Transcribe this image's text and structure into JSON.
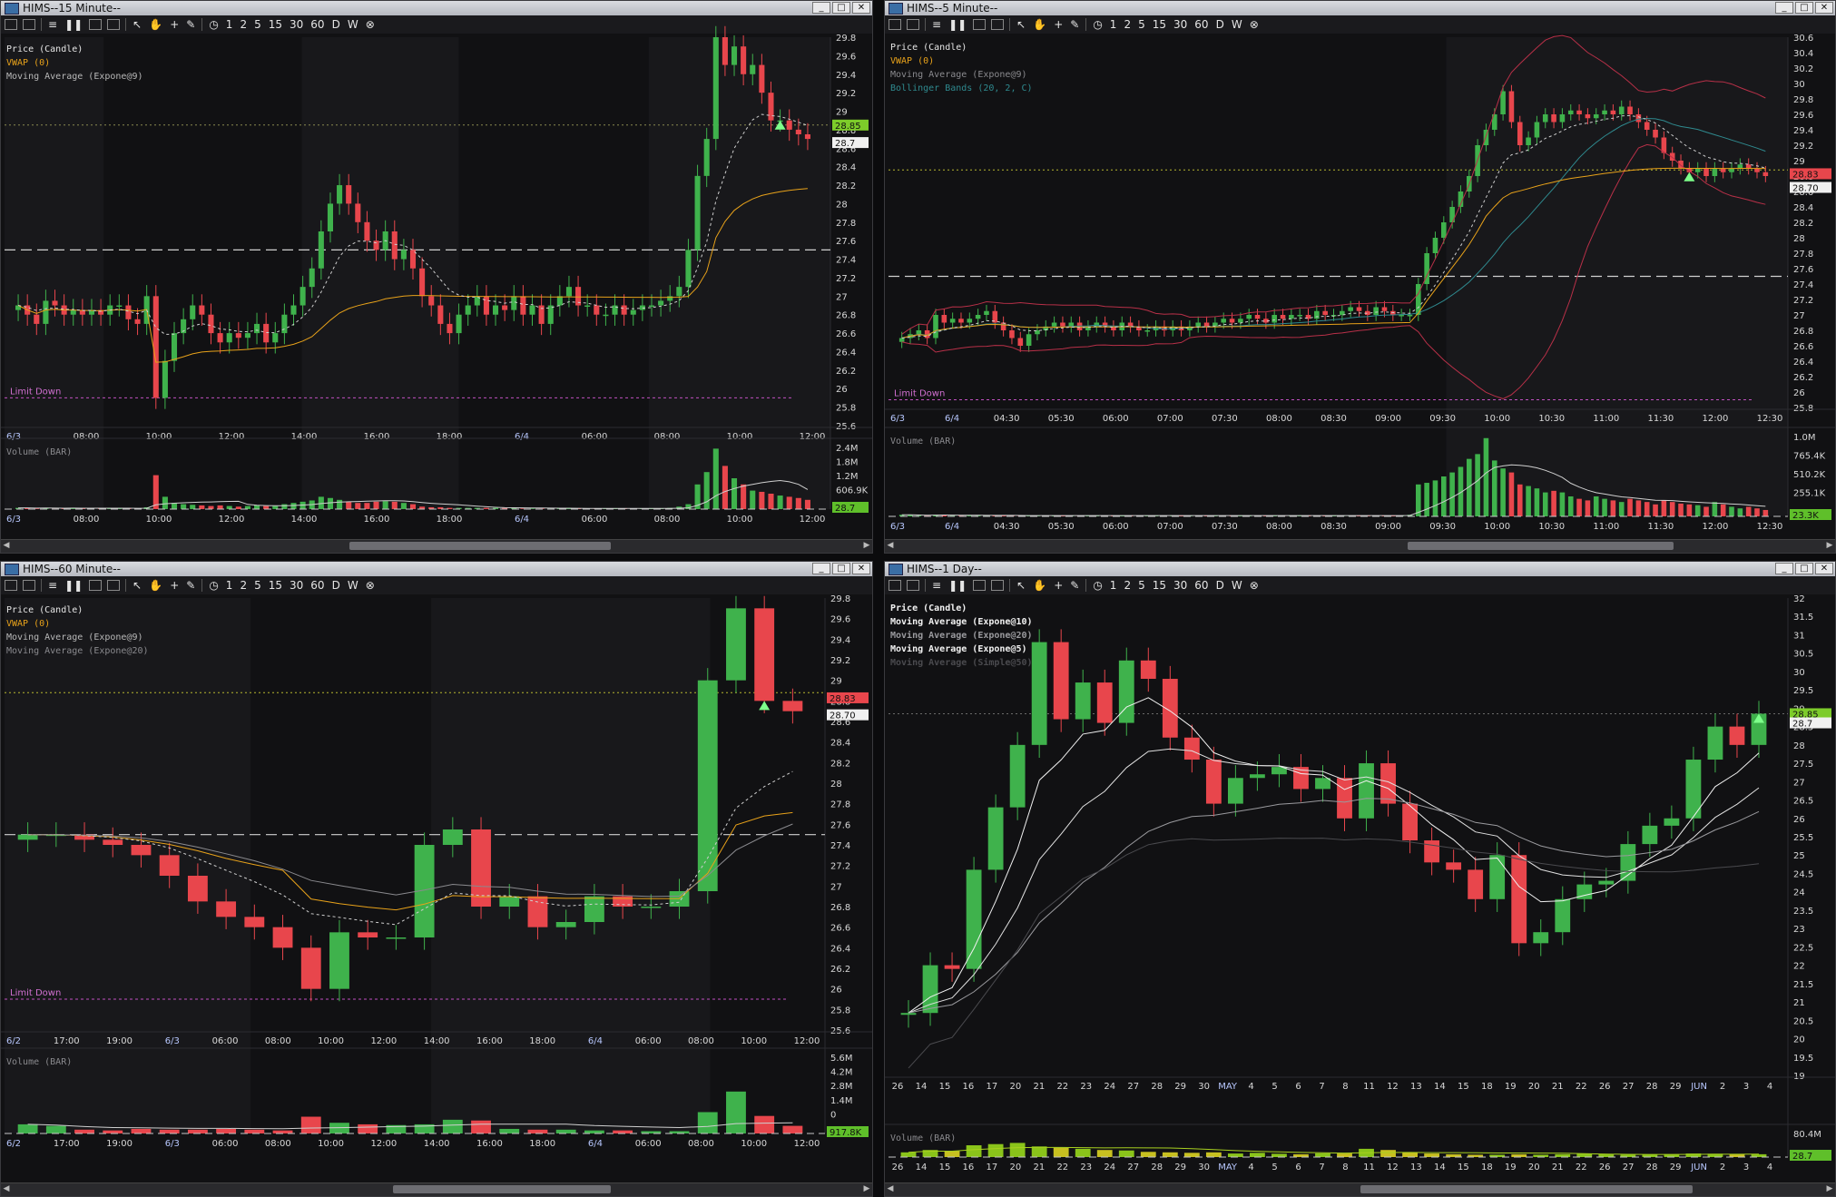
{
  "panels": [
    {
      "id": "p15",
      "title": "HIMS--15 Minute--",
      "legend": [
        {
          "text": "Price (Candle)",
          "color": "#e6e6e6"
        },
        {
          "text": "VWAP (0)",
          "color": "#e8a21a"
        },
        {
          "text": "Moving Average (Expone@9)",
          "color": "#b8b8b8"
        }
      ],
      "yticks": [
        "29.8",
        "29.6",
        "29.4",
        "29.2",
        "29",
        "28.8",
        "28.6",
        "28.4",
        "28.2",
        "28",
        "27.8",
        "27.6",
        "27.4",
        "27.2",
        "27",
        "26.8",
        "26.6",
        "26.4",
        "26.2",
        "26",
        "25.8",
        "25.6"
      ],
      "ymin": 25.6,
      "ymax": 29.8,
      "xticks": [
        "6/3",
        "08:00",
        "10:00",
        "12:00",
        "14:00",
        "16:00",
        "18:00",
        "6/4",
        "06:00",
        "08:00",
        "10:00",
        "12:00"
      ],
      "price_badges": [
        "28.85",
        "28.7"
      ],
      "limit_label": "Limit Down",
      "limit_value": 25.9,
      "dashed_level": 27.5,
      "dotted_level": 28.85,
      "volume_label": "Volume (BAR)",
      "volume_ticks": [
        "2.4M",
        "1.8M",
        "1.2M",
        "606.9K"
      ],
      "volume_badge": "28.7",
      "closes": [
        26.9,
        26.8,
        26.7,
        26.95,
        26.9,
        26.8,
        26.85,
        26.8,
        26.85,
        26.8,
        26.9,
        26.9,
        26.75,
        26.7,
        27.0,
        25.9,
        26.3,
        26.6,
        26.75,
        26.9,
        26.8,
        26.6,
        26.5,
        26.6,
        26.55,
        26.6,
        26.7,
        26.5,
        26.6,
        26.8,
        26.9,
        27.1,
        27.3,
        27.7,
        28.0,
        28.2,
        28.0,
        27.8,
        27.6,
        27.5,
        27.7,
        27.4,
        27.5,
        27.3,
        27.0,
        26.9,
        26.7,
        26.6,
        26.8,
        26.9,
        27.0,
        26.8,
        26.9,
        26.85,
        27.0,
        26.8,
        26.9,
        26.7,
        26.9,
        27.0,
        27.1,
        26.9,
        26.9,
        26.8,
        26.8,
        26.9,
        26.8,
        26.85,
        26.9,
        26.9,
        26.95,
        27.0,
        27.1,
        27.5,
        28.3,
        28.7,
        29.8,
        29.5,
        29.7,
        29.4,
        29.5,
        29.2,
        28.9,
        28.9,
        28.8,
        28.75,
        28.7
      ],
      "volumes": [
        0.02,
        0.02,
        0.01,
        0.02,
        0.01,
        0.01,
        0.02,
        0.01,
        0.01,
        0.01,
        0.02,
        0.02,
        0.01,
        0.01,
        0.03,
        0.55,
        0.2,
        0.1,
        0.08,
        0.07,
        0.06,
        0.05,
        0.06,
        0.05,
        0.04,
        0.05,
        0.06,
        0.05,
        0.05,
        0.08,
        0.1,
        0.12,
        0.14,
        0.2,
        0.18,
        0.15,
        0.12,
        0.1,
        0.1,
        0.12,
        0.13,
        0.12,
        0.1,
        0.08,
        0.04,
        0.03,
        0.03,
        0.02,
        0.02,
        0.02,
        0.02,
        0.02,
        0.02,
        0.02,
        0.02,
        0.01,
        0.01,
        0.01,
        0.01,
        0.01,
        0.01,
        0.01,
        0.01,
        0.01,
        0.01,
        0.01,
        0.01,
        0.01,
        0.01,
        0.01,
        0.01,
        0.02,
        0.04,
        0.08,
        0.4,
        0.6,
        0.98,
        0.7,
        0.5,
        0.4,
        0.3,
        0.28,
        0.25,
        0.22,
        0.2,
        0.18,
        0.15
      ]
    },
    {
      "id": "p5",
      "title": "HIMS--5 Minute--",
      "legend": [
        {
          "text": "Price (Candle)",
          "color": "#e6e6e6"
        },
        {
          "text": "VWAP (0)",
          "color": "#e8a21a"
        },
        {
          "text": "Moving Average (Expone@9)",
          "color": "#8a8a8e"
        },
        {
          "text": "Bollinger Bands (20, 2, C)",
          "color": "#2f8a8f"
        }
      ],
      "yticks": [
        "30.6",
        "30.4",
        "30.2",
        "30",
        "29.8",
        "29.6",
        "29.4",
        "29.2",
        "29",
        "28.8",
        "28.6",
        "28.4",
        "28.2",
        "28",
        "27.8",
        "27.6",
        "27.4",
        "27.2",
        "27",
        "26.8",
        "26.6",
        "26.4",
        "26.2",
        "26",
        "25.8"
      ],
      "ymin": 25.8,
      "ymax": 30.6,
      "xticks": [
        "6/3",
        "6/4",
        "04:30",
        "05:30",
        "06:00",
        "07:00",
        "07:30",
        "08:00",
        "08:30",
        "09:00",
        "09:30",
        "10:00",
        "10:30",
        "11:00",
        "11:30",
        "12:00",
        "12:30"
      ],
      "price_badges": [
        "28.83",
        "28.70"
      ],
      "limit_label": "Limit Down",
      "limit_value": 25.9,
      "dashed_level": 27.5,
      "dotted_level": 28.88,
      "volume_label": "Volume (BAR)",
      "volume_ticks": [
        "1.0M",
        "765.4K",
        "510.2K",
        "255.1K"
      ],
      "volume_badge": "23.3K",
      "closes": [
        26.7,
        26.75,
        26.8,
        26.7,
        27.0,
        26.9,
        26.95,
        26.9,
        26.95,
        27.0,
        27.05,
        26.9,
        26.8,
        26.7,
        26.6,
        26.75,
        26.8,
        26.85,
        26.9,
        26.85,
        26.9,
        26.8,
        26.85,
        26.9,
        26.85,
        26.8,
        26.9,
        26.85,
        26.8,
        26.8,
        26.85,
        26.8,
        26.85,
        26.8,
        26.85,
        26.9,
        26.85,
        26.9,
        26.95,
        26.9,
        26.95,
        27.0,
        26.95,
        26.9,
        27.0,
        26.95,
        27.0,
        27.0,
        26.95,
        27.05,
        27.0,
        27.0,
        27.05,
        27.1,
        27.05,
        27.0,
        27.1,
        27.05,
        27.0,
        27.0,
        27.0,
        27.4,
        27.8,
        28.0,
        28.2,
        28.4,
        28.6,
        28.8,
        29.2,
        29.4,
        29.6,
        29.9,
        29.5,
        29.2,
        29.3,
        29.5,
        29.6,
        29.5,
        29.6,
        29.65,
        29.6,
        29.55,
        29.6,
        29.65,
        29.6,
        29.7,
        29.6,
        29.5,
        29.4,
        29.3,
        29.1,
        29.0,
        28.9,
        28.85,
        28.9,
        28.8,
        28.9,
        28.85,
        28.9,
        28.95,
        28.9,
        28.85,
        28.8
      ],
      "volumes": [
        0.02,
        0.02,
        0.01,
        0.01,
        0.02,
        0.02,
        0.01,
        0.01,
        0.01,
        0.01,
        0.01,
        0.01,
        0.01,
        0.01,
        0.01,
        0.01,
        0.01,
        0.01,
        0.01,
        0.01,
        0.01,
        0.01,
        0.01,
        0.01,
        0.01,
        0.01,
        0.01,
        0.01,
        0.01,
        0.01,
        0.01,
        0.01,
        0.01,
        0.01,
        0.01,
        0.01,
        0.01,
        0.01,
        0.01,
        0.01,
        0.01,
        0.01,
        0.01,
        0.01,
        0.01,
        0.01,
        0.01,
        0.01,
        0.01,
        0.01,
        0.01,
        0.01,
        0.01,
        0.01,
        0.01,
        0.01,
        0.01,
        0.01,
        0.01,
        0.01,
        0.02,
        0.4,
        0.42,
        0.45,
        0.5,
        0.55,
        0.62,
        0.72,
        0.78,
        0.98,
        0.7,
        0.6,
        0.55,
        0.4,
        0.38,
        0.35,
        0.3,
        0.32,
        0.3,
        0.25,
        0.22,
        0.2,
        0.25,
        0.22,
        0.2,
        0.18,
        0.22,
        0.2,
        0.18,
        0.15,
        0.2,
        0.18,
        0.16,
        0.15,
        0.14,
        0.12,
        0.18,
        0.15,
        0.12,
        0.1,
        0.12,
        0.1,
        0.08
      ]
    },
    {
      "id": "p60",
      "title": "HIMS--60 Minute--",
      "legend": [
        {
          "text": "Price (Candle)",
          "color": "#e6e6e6"
        },
        {
          "text": "VWAP (0)",
          "color": "#e8a21a"
        },
        {
          "text": "Moving Average (Expone@9)",
          "color": "#b8b8b8"
        },
        {
          "text": "Moving Average (Expone@20)",
          "color": "#8a8a8e"
        }
      ],
      "yticks": [
        "29.8",
        "29.6",
        "29.4",
        "29.2",
        "29",
        "28.8",
        "28.6",
        "28.4",
        "28.2",
        "28",
        "27.8",
        "27.6",
        "27.4",
        "27.2",
        "27",
        "26.8",
        "26.6",
        "26.4",
        "26.2",
        "26",
        "25.8",
        "25.6"
      ],
      "ymin": 25.6,
      "ymax": 29.8,
      "xticks": [
        "6/2",
        "17:00",
        "19:00",
        "6/3",
        "06:00",
        "08:00",
        "10:00",
        "12:00",
        "14:00",
        "16:00",
        "18:00",
        "6/4",
        "06:00",
        "08:00",
        "10:00",
        "12:00"
      ],
      "price_badges": [
        "28.83",
        "28.70"
      ],
      "limit_label": "Limit Down",
      "limit_value": 25.9,
      "dashed_level": 27.5,
      "dotted_level": 28.88,
      "volume_label": "Volume (BAR)",
      "volume_ticks": [
        "5.6M",
        "4.2M",
        "2.8M",
        "1.4M",
        "0"
      ],
      "volume_badge": "917.8K",
      "closes": [
        27.5,
        27.5,
        27.45,
        27.4,
        27.3,
        27.1,
        26.85,
        26.7,
        26.6,
        26.4,
        26.0,
        26.55,
        26.5,
        26.5,
        27.4,
        27.55,
        26.8,
        26.9,
        26.6,
        26.65,
        26.9,
        26.8,
        26.8,
        26.95,
        29.0,
        29.7,
        28.8,
        28.7
      ],
      "volumes": [
        0.12,
        0.1,
        0.05,
        0.04,
        0.06,
        0.05,
        0.05,
        0.06,
        0.05,
        0.04,
        0.22,
        0.14,
        0.12,
        0.11,
        0.12,
        0.18,
        0.17,
        0.06,
        0.05,
        0.05,
        0.04,
        0.04,
        0.03,
        0.03,
        0.28,
        0.55,
        0.23,
        0.1
      ]
    },
    {
      "id": "p1d",
      "title": "HIMS--1 Day--",
      "legend": [
        {
          "text": "Price (Candle)",
          "color": "#f2f2f2"
        },
        {
          "text": "Moving Average (Expone@10)",
          "color": "#f2f2f2"
        },
        {
          "text": "Moving Average (Expone@20)",
          "color": "#9a9a9e"
        },
        {
          "text": "Moving Average (Expone@5)",
          "color": "#f2f2f2"
        },
        {
          "text": "Moving Average (Simple@50)",
          "color": "#4a4a4e"
        }
      ],
      "yticks": [
        "32",
        "31.5",
        "31",
        "30.5",
        "30",
        "29.5",
        "29",
        "28.5",
        "28",
        "27.5",
        "27",
        "26.5",
        "26",
        "25.5",
        "25",
        "24.5",
        "24",
        "23.5",
        "23",
        "22.5",
        "22",
        "21.5",
        "21",
        "20.5",
        "20",
        "19.5",
        "19"
      ],
      "ymin": 19,
      "ymax": 32,
      "xticks": [
        "26",
        "14",
        "15",
        "16",
        "17",
        "20",
        "21",
        "22",
        "23",
        "24",
        "27",
        "28",
        "29",
        "30",
        "MAY",
        "4",
        "5",
        "6",
        "7",
        "8",
        "11",
        "12",
        "13",
        "14",
        "15",
        "18",
        "19",
        "20",
        "21",
        "22",
        "26",
        "27",
        "28",
        "29",
        "JUN",
        "2",
        "3",
        "4"
      ],
      "price_badges": [
        "28.85",
        "28.7"
      ],
      "limit_label": "",
      "limit_value": null,
      "dashed_level": null,
      "dotted_level": 28.85,
      "volume_label": "Volume (BAR)",
      "volume_ticks": [
        "80.4M"
      ],
      "volume_badge": "28.7",
      "closes": [
        20.7,
        22.0,
        21.9,
        24.6,
        26.3,
        28.0,
        30.8,
        28.7,
        29.7,
        28.6,
        30.3,
        29.8,
        28.2,
        27.6,
        26.4,
        27.1,
        27.2,
        27.4,
        26.8,
        27.1,
        26.0,
        27.5,
        26.4,
        25.4,
        24.8,
        24.6,
        23.8,
        25.0,
        22.6,
        22.9,
        23.8,
        24.2,
        24.3,
        25.3,
        25.8,
        26.0,
        27.6,
        28.5,
        28.0,
        28.85
      ],
      "volumes": [
        0.2,
        0.3,
        0.25,
        0.5,
        0.55,
        0.6,
        0.45,
        0.4,
        0.35,
        0.3,
        0.28,
        0.22,
        0.2,
        0.18,
        0.2,
        0.15,
        0.18,
        0.14,
        0.12,
        0.16,
        0.15,
        0.35,
        0.3,
        0.2,
        0.15,
        0.12,
        0.1,
        0.1,
        0.12,
        0.1,
        0.12,
        0.14,
        0.12,
        0.1,
        0.1,
        0.12,
        0.15,
        0.14,
        0.12,
        0.12
      ]
    }
  ]
}
